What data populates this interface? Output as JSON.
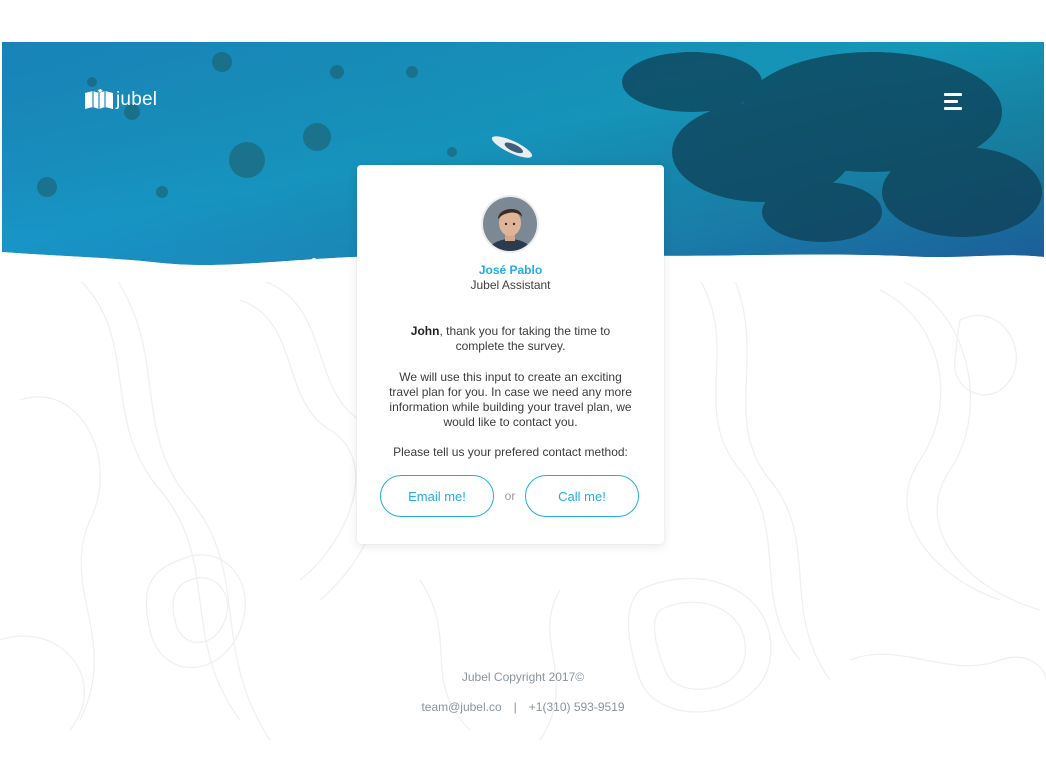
{
  "brand": {
    "name": "jubel"
  },
  "colors": {
    "accent": "#23aee3",
    "ocean_dark": "#0f5f86",
    "ocean_light": "#1aa7c9"
  },
  "icons": {
    "logo": "book-map-icon",
    "menu": "hamburger-menu-icon",
    "avatar": "user-avatar"
  },
  "card": {
    "agent_name": "José Pablo",
    "agent_role": "Jubel Assistant",
    "user_name": "John",
    "thanks_text": ", thank you for taking the time to complete the survey.",
    "info_text": "We will use this input to create an exciting travel plan for you.  In case we need any more information while building your travel plan, we would like to contact you.",
    "prompt_text": "Please tell us your prefered contact method:",
    "email_button": "Email me!",
    "or_text": "or",
    "call_button": "Call me!"
  },
  "footer": {
    "copyright": "Jubel Copyright 2017©",
    "email": "team@jubel.co",
    "separator": "|",
    "phone": "+1(310) 593-9519"
  }
}
